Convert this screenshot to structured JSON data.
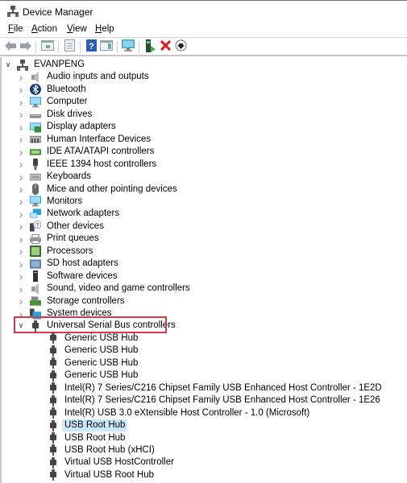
{
  "window": {
    "title": "Device Manager",
    "icon": "device-manager-icon"
  },
  "menu": [
    {
      "label": "File",
      "accel": "F",
      "rest": "ile"
    },
    {
      "label": "Action",
      "accel": "A",
      "rest": "ction"
    },
    {
      "label": "View",
      "accel": "V",
      "rest": "iew"
    },
    {
      "label": "Help",
      "accel": "H",
      "rest": "elp"
    }
  ],
  "toolbar": [
    {
      "name": "back-button",
      "icon": "arrow-left-icon"
    },
    {
      "name": "forward-button",
      "icon": "arrow-right-icon"
    },
    {
      "name": "show-hide-console-tree-button",
      "icon": "console-tree-icon"
    },
    {
      "name": "properties-button",
      "icon": "properties-icon"
    },
    {
      "name": "help-button",
      "icon": "help-icon"
    },
    {
      "name": "action-pane-button",
      "icon": "action-pane-icon"
    },
    {
      "name": "scan-hardware-button",
      "icon": "monitor-scan-icon"
    },
    {
      "name": "update-driver-button",
      "icon": "update-driver-icon"
    },
    {
      "name": "uninstall-device-button",
      "icon": "red-x-icon"
    },
    {
      "name": "disable-device-button",
      "icon": "down-arrow-circle-icon"
    }
  ],
  "tree": {
    "root": {
      "label": "EVANPENG",
      "expanded": true
    },
    "categories": [
      {
        "label": "Audio inputs and outputs",
        "icon": "speaker-icon"
      },
      {
        "label": "Bluetooth",
        "icon": "bluetooth-icon"
      },
      {
        "label": "Computer",
        "icon": "computer-icon"
      },
      {
        "label": "Disk drives",
        "icon": "disk-drive-icon"
      },
      {
        "label": "Display adapters",
        "icon": "display-adapter-icon"
      },
      {
        "label": "Human Interface Devices",
        "icon": "hid-icon"
      },
      {
        "label": "IDE ATA/ATAPI controllers",
        "icon": "ide-controller-icon"
      },
      {
        "label": "IEEE 1394 host controllers",
        "icon": "ieee1394-icon"
      },
      {
        "label": "Keyboards",
        "icon": "keyboard-icon"
      },
      {
        "label": "Mice and other pointing devices",
        "icon": "mouse-icon"
      },
      {
        "label": "Monitors",
        "icon": "monitor-icon"
      },
      {
        "label": "Network adapters",
        "icon": "network-adapter-icon"
      },
      {
        "label": "Other devices",
        "icon": "unknown-device-icon"
      },
      {
        "label": "Print queues",
        "icon": "printer-icon"
      },
      {
        "label": "Processors",
        "icon": "processor-icon"
      },
      {
        "label": "SD host adapters",
        "icon": "sd-adapter-icon"
      },
      {
        "label": "Software devices",
        "icon": "software-device-icon"
      },
      {
        "label": "Sound, video and game controllers",
        "icon": "speaker-icon"
      },
      {
        "label": "Storage controllers",
        "icon": "storage-controller-icon"
      },
      {
        "label": "System devices",
        "icon": "system-device-icon"
      }
    ],
    "usb": {
      "label": "Universal Serial Bus controllers",
      "expanded": true,
      "highlighted": true,
      "children": [
        {
          "label": "Generic USB Hub"
        },
        {
          "label": "Generic USB Hub"
        },
        {
          "label": "Generic USB Hub"
        },
        {
          "label": "Generic USB Hub"
        },
        {
          "label": "Intel(R) 7 Series/C216 Chipset Family USB Enhanced Host Controller - 1E2D"
        },
        {
          "label": "Intel(R) 7 Series/C216 Chipset Family USB Enhanced Host Controller - 1E26"
        },
        {
          "label": "Intel(R) USB 3.0 eXtensible Host Controller - 1.0 (Microsoft)"
        },
        {
          "label": "USB Root Hub",
          "selected": true
        },
        {
          "label": "USB Root Hub"
        },
        {
          "label": "USB Root Hub (xHCI)"
        },
        {
          "label": "Virtual USB HostController"
        },
        {
          "label": "Virtual USB Root Hub"
        }
      ]
    }
  },
  "colors": {
    "selection": "#cce8ff",
    "highlight_box": "#d8394a"
  }
}
